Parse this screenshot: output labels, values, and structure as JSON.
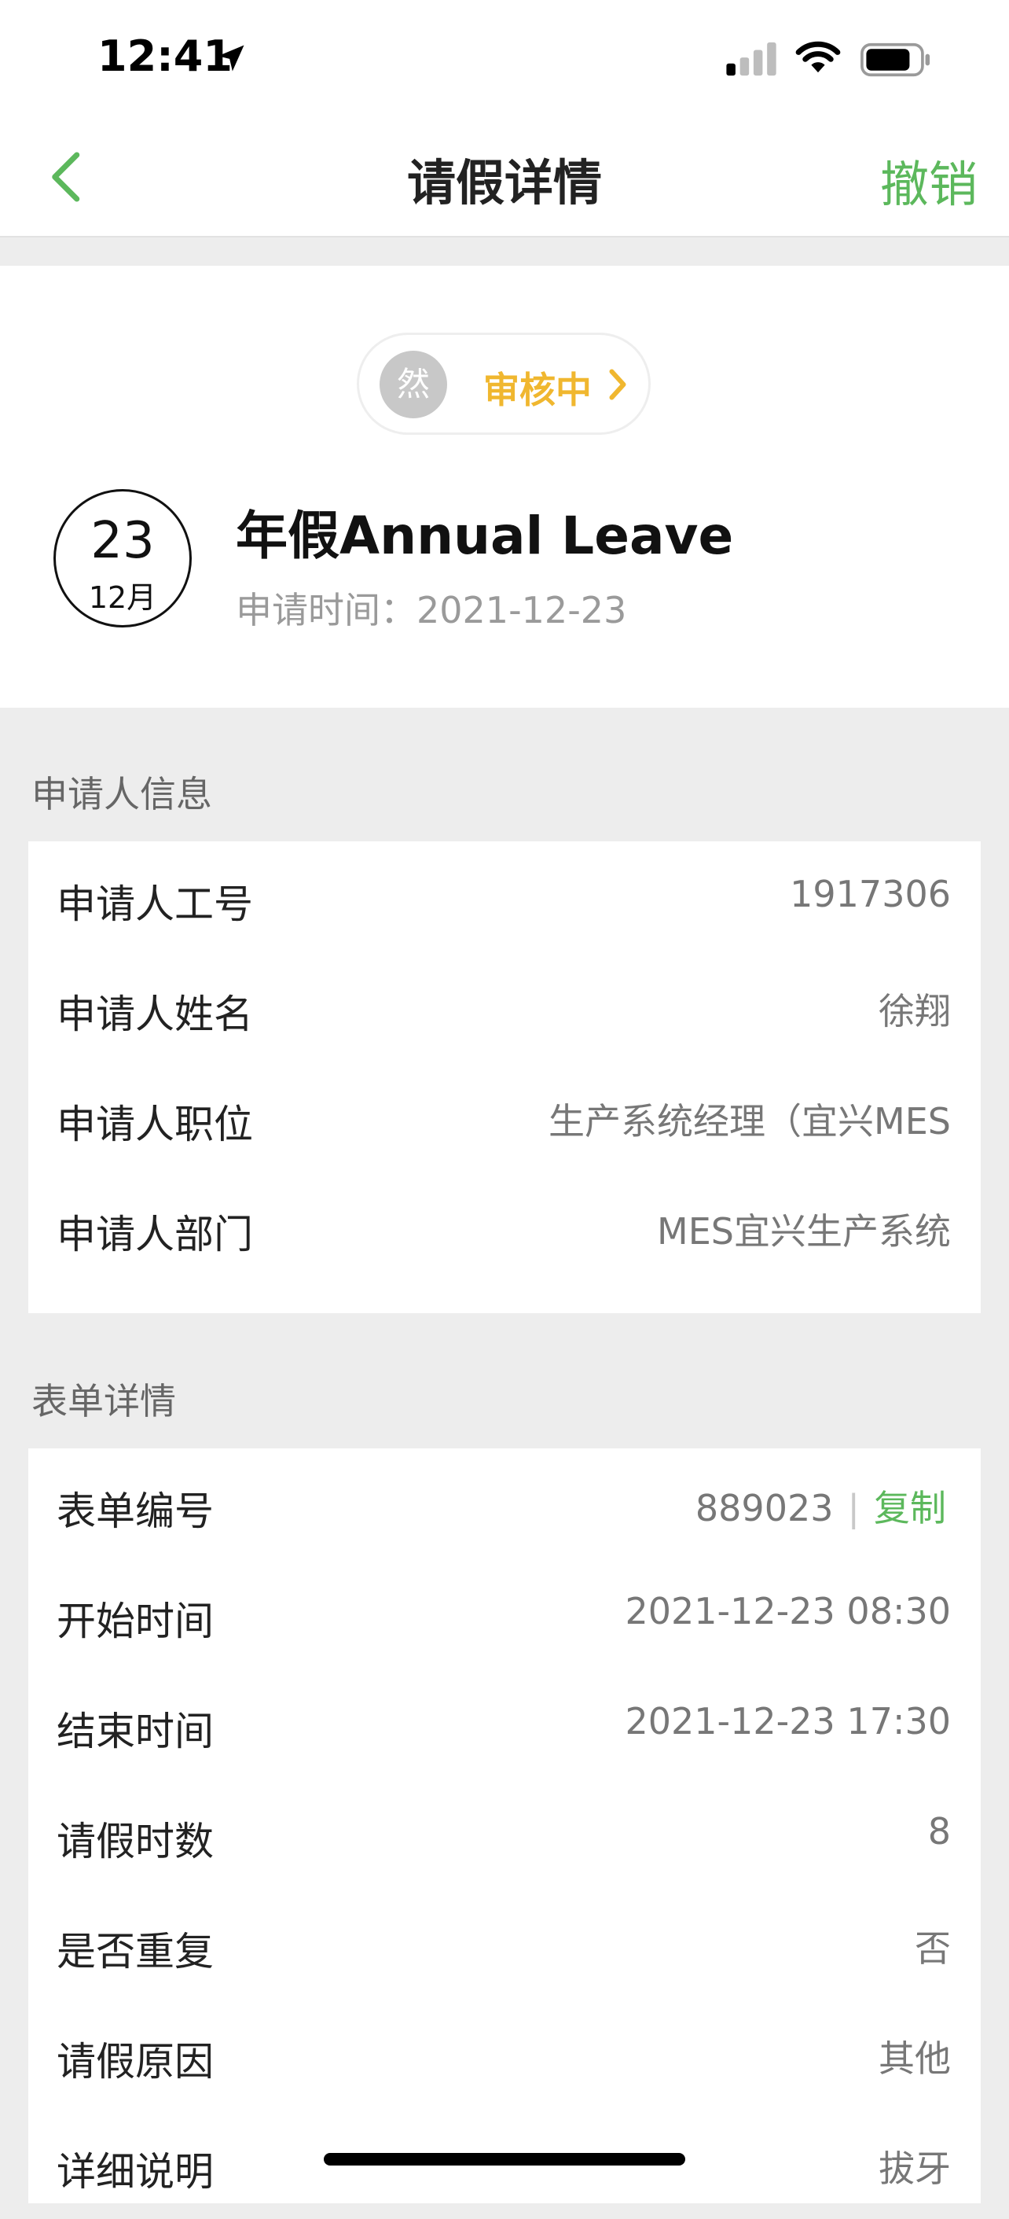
{
  "status_bar": {
    "time": "12:41"
  },
  "nav": {
    "title": "请假详情",
    "revoke_label": "撤销"
  },
  "header": {
    "approver_avatar": "然",
    "status_text": "审核中",
    "date_day": "23",
    "date_month": "12月",
    "leave_type": "年假Annual Leave",
    "apply_time": "申请时间：2021-12-23"
  },
  "applicant": {
    "section_title": "申请人信息",
    "rows": [
      {
        "label": "申请人工号",
        "value": "1917306"
      },
      {
        "label": "申请人姓名",
        "value": "徐翔"
      },
      {
        "label": "申请人职位",
        "value": "生产系统经理（宜兴MES"
      },
      {
        "label": "申请人部门",
        "value": "MES宜兴生产系统"
      }
    ]
  },
  "form": {
    "section_title": "表单详情",
    "form_no_label": "表单编号",
    "form_no_value": "889023",
    "copy_separator": "|",
    "copy_label": "复制",
    "rows": [
      {
        "label": "开始时间",
        "value": "2021-12-23 08:30"
      },
      {
        "label": "结束时间",
        "value": "2021-12-23 17:30"
      },
      {
        "label": "请假时数",
        "value": "8"
      },
      {
        "label": "是否重复",
        "value": "否"
      },
      {
        "label": "请假原因",
        "value": "其他"
      },
      {
        "label": "详细说明",
        "value": "拔牙"
      }
    ]
  },
  "colors": {
    "accent_green": "#5cb85c",
    "status_yellow": "#f0b72f"
  }
}
